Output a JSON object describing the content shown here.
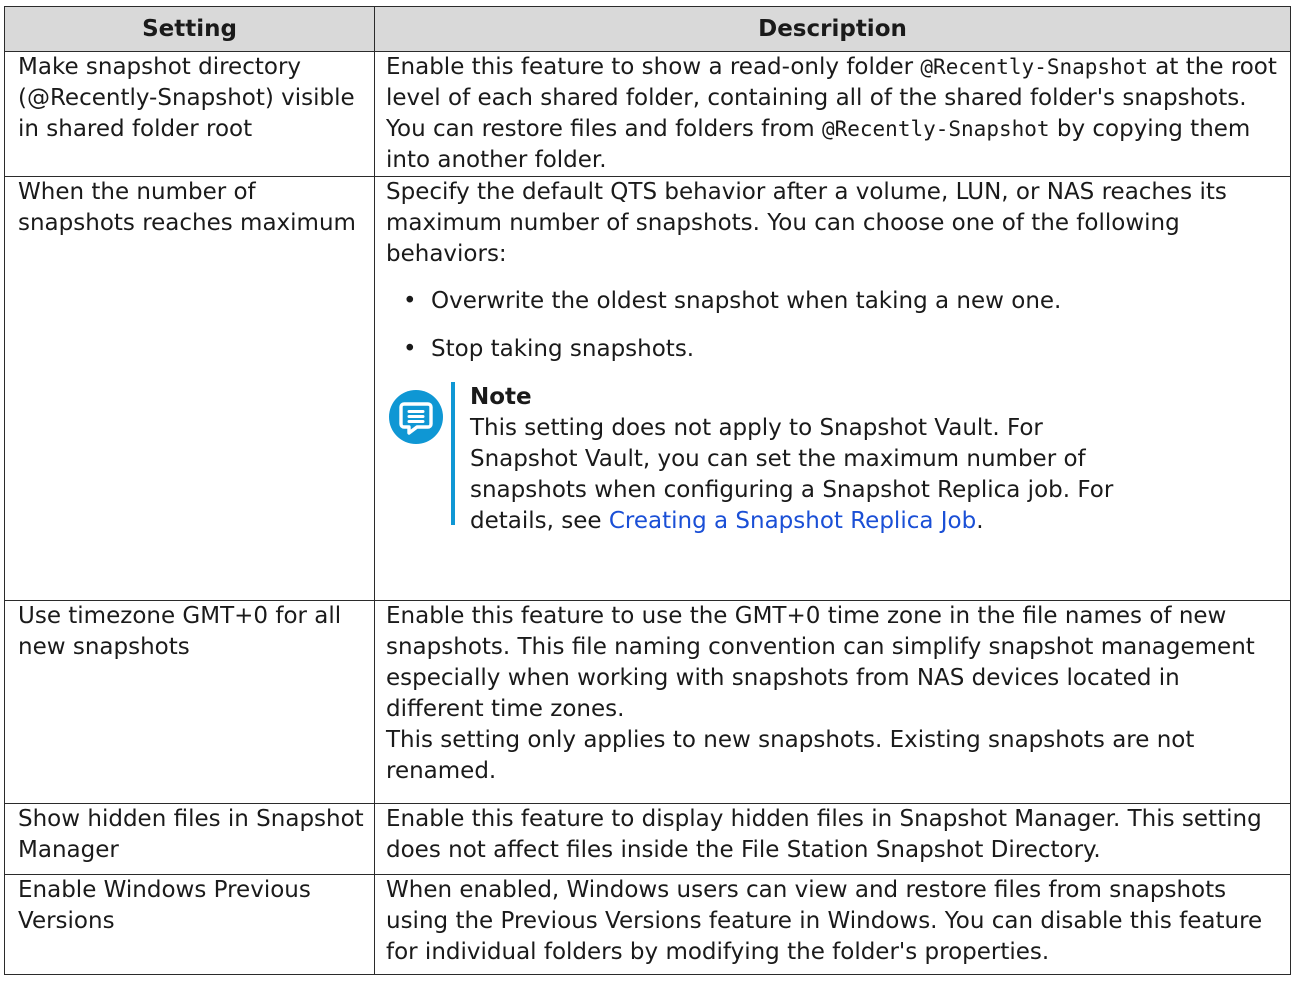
{
  "table": {
    "headers": [
      "Setting",
      "Description"
    ],
    "row1": {
      "setting": "Make snapshot directory (@Recently-Snapshot) visible in shared folder root",
      "d1": "Enable this feature to show a read-only folder ",
      "code1": "@Recently-Snapshot",
      "d2": " at the root level of each shared folder, containing all of the shared folder's snapshots. You can restore files and folders from ",
      "code2": "@Recently-Snapshot",
      "d3": " by copying them into another folder."
    },
    "row2": {
      "setting": "When the number of snapshots reaches maximum",
      "intro": "Specify the default QTS behavior after a volume, LUN, or NAS reaches its maximum number of snapshots. You can choose one of the following behaviors:",
      "bullet_glyph": "•",
      "bullets": [
        "Overwrite the oldest snapshot when taking a new one.",
        "Stop taking snapshots."
      ],
      "note_title": "Note",
      "note_text": "This setting does not apply to Snapshot Vault. For Snapshot Vault, you can set the maximum number of snapshots when configuring a Snapshot Replica job. For details, see ",
      "note_link": "Creating a Snapshot Replica Job",
      "note_end": ".",
      "note_icon": "note-icon",
      "accent_color": "#0f97d4"
    },
    "row3": {
      "setting": "Use timezone GMT+0 for all new snapshots",
      "p1": "Enable this feature to use the GMT+0 time zone in the file names of new snapshots. This file naming convention can simplify snapshot management especially when working with snapshots from NAS devices located in different time zones.",
      "p2": "This setting only applies to new snapshots. Existing snapshots are not renamed."
    },
    "row4": {
      "setting": "Show hidden files in Snapshot Manager",
      "desc": "Enable this feature to display hidden files in Snapshot Manager. This setting does not affect files inside the File Station Snapshot Directory."
    },
    "row5": {
      "setting": "Enable Windows Previous Versions",
      "desc": "When enabled, Windows users can view and restore files from snapshots using the Previous Versions feature in Windows. You can disable this feature for individual folders by modifying the folder's properties."
    }
  }
}
